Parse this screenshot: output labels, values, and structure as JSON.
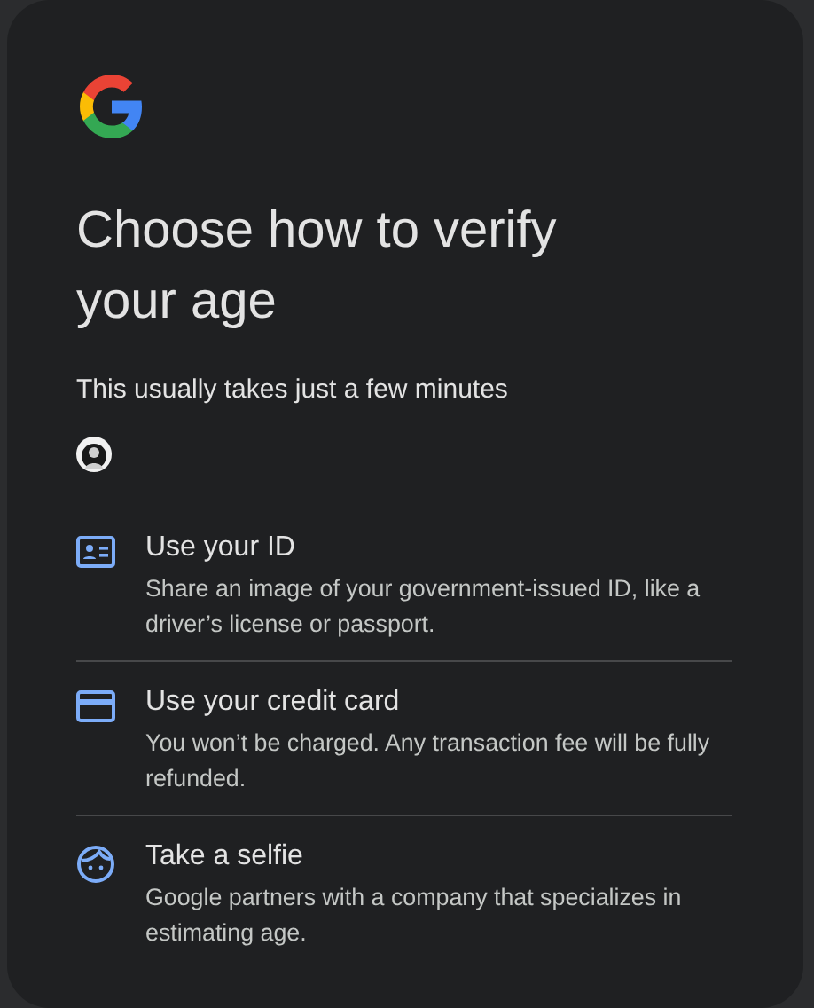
{
  "title": "Choose how to verify your age",
  "subtitle": "This usually takes just a few minutes",
  "options": [
    {
      "kind": "id",
      "title": "Use your ID",
      "description": "Share an image of your government-issued ID, like a driver’s license or passport."
    },
    {
      "kind": "card",
      "title": "Use your credit card",
      "description": "You won’t be charged. Any transaction fee will be fully refunded."
    },
    {
      "kind": "selfie",
      "title": "Take a selfie",
      "description": "Google partners with a company that specializes in estimating age."
    }
  ]
}
